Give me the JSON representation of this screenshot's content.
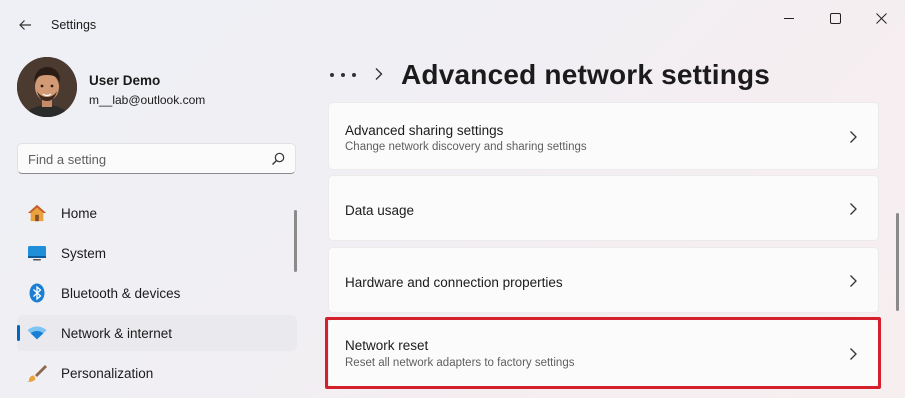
{
  "window": {
    "title": "Settings",
    "controls": {
      "minimize": "minimize-icon",
      "maximize": "maximize-icon",
      "close": "close-icon"
    }
  },
  "profile": {
    "name": "User Demo",
    "email": "m__lab@outlook.com"
  },
  "search": {
    "placeholder": "Find a setting"
  },
  "sidebar": {
    "items": [
      {
        "label": "Home",
        "icon": "home-icon",
        "selected": false
      },
      {
        "label": "System",
        "icon": "system-icon",
        "selected": false
      },
      {
        "label": "Bluetooth & devices",
        "icon": "bluetooth-icon",
        "selected": false
      },
      {
        "label": "Network & internet",
        "icon": "wifi-icon",
        "selected": true
      },
      {
        "label": "Personalization",
        "icon": "brush-icon",
        "selected": false
      }
    ]
  },
  "header": {
    "title": "Advanced network settings"
  },
  "settings": [
    {
      "title": "Advanced sharing settings",
      "subtitle": "Change network discovery and sharing settings"
    },
    {
      "title": "Data usage",
      "subtitle": ""
    },
    {
      "title": "Hardware and connection properties",
      "subtitle": ""
    },
    {
      "title": "Network reset",
      "subtitle": "Reset all network adapters to factory settings",
      "highlighted": true
    }
  ],
  "colors": {
    "accent": "#0067c0",
    "highlight": "#d3202a"
  }
}
